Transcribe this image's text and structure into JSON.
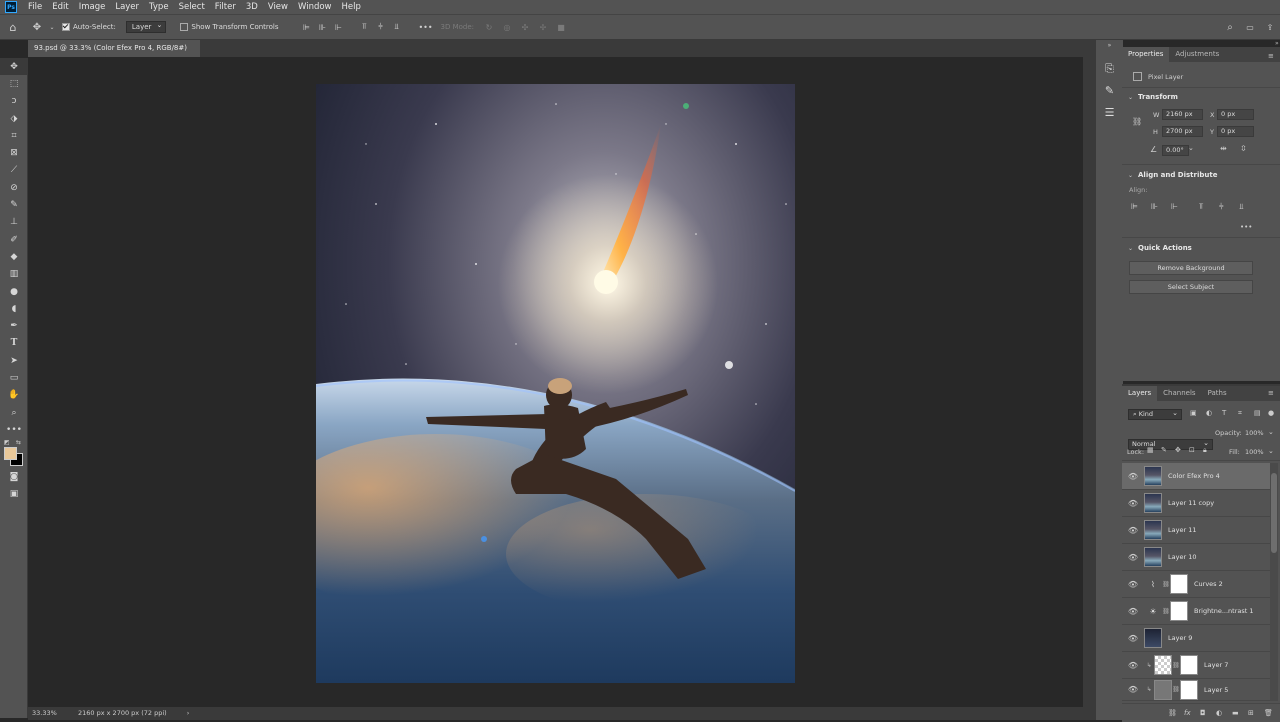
{
  "menu": {
    "items": [
      "File",
      "Edit",
      "Image",
      "Layer",
      "Type",
      "Select",
      "Filter",
      "3D",
      "View",
      "Window",
      "Help"
    ],
    "logo": "Ps"
  },
  "options": {
    "auto_select_label": "Auto-Select:",
    "auto_select_target": "Layer",
    "show_transform_label": "Show Transform Controls",
    "mode_3d_label": "3D Mode:",
    "more": "•••"
  },
  "document": {
    "tab_title": "93.psd @ 33.3% (Color Efex Pro 4, RGB/8#) *",
    "close": "×"
  },
  "status": {
    "zoom": "33.33%",
    "dimensions": "2160 px x 2700 px (72 ppi)",
    "arrow": "›"
  },
  "properties": {
    "tabs": [
      "Properties",
      "Adjustments"
    ],
    "layer_type": "Pixel Layer",
    "transform": {
      "heading": "Transform",
      "w_label": "W",
      "w": "2160 px",
      "h_label": "H",
      "h": "2700 px",
      "x_label": "X",
      "x": "0 px",
      "y_label": "Y",
      "y": "0 px",
      "angle": "0.00°"
    },
    "align": {
      "heading": "Align and Distribute",
      "align_label": "Align:",
      "more": "•••"
    },
    "quick_actions": {
      "heading": "Quick Actions",
      "remove_bg": "Remove Background",
      "select_subject": "Select Subject"
    }
  },
  "layers_panel": {
    "tabs": [
      "Layers",
      "Channels",
      "Paths"
    ],
    "filter_kind": "Kind",
    "blend_mode": "Normal",
    "opacity_label": "Opacity:",
    "opacity": "100%",
    "lock_label": "Lock:",
    "fill_label": "Fill:",
    "fill": "100%",
    "layers": [
      {
        "name": "Color Efex Pro 4",
        "selected": true
      },
      {
        "name": "Layer 11 copy"
      },
      {
        "name": "Layer 11"
      },
      {
        "name": "Layer 10"
      },
      {
        "name": "Curves 2"
      },
      {
        "name": "Brightne...ntrast 1"
      },
      {
        "name": "Layer 9"
      },
      {
        "name": "Layer 7"
      },
      {
        "name": "Layer 5"
      }
    ],
    "footer_fx": "fx"
  },
  "colors": {
    "ui_dark": "#282828",
    "ui_panel": "#535353",
    "foreground": "#e8c89a",
    "background": "#000000"
  }
}
